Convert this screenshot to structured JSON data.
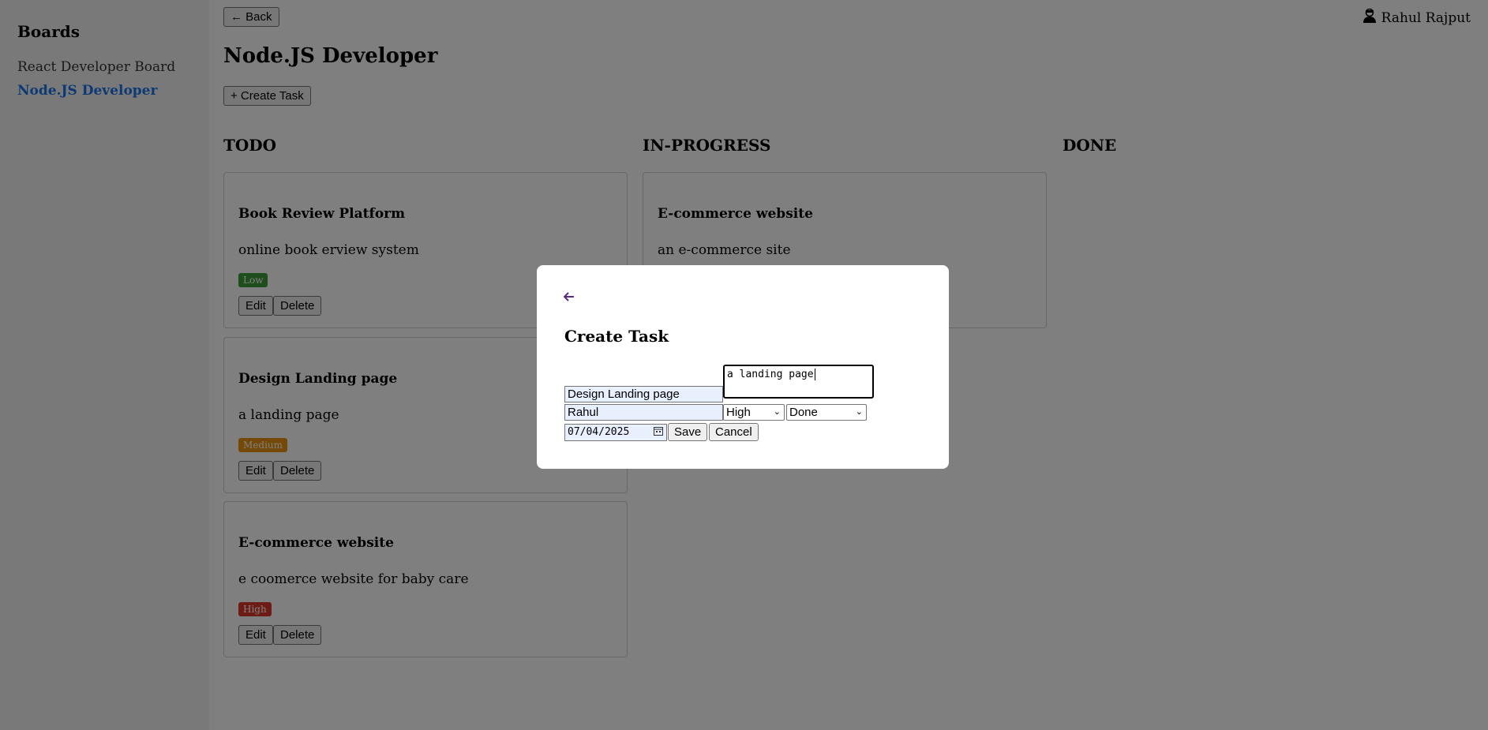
{
  "sidebar": {
    "heading": "Boards",
    "items": [
      {
        "label": "React Developer Board"
      },
      {
        "label": "Node.JS Developer"
      }
    ]
  },
  "header": {
    "back_label": "← Back",
    "title": "Node.JS Developer",
    "create_task_label": "+ Create Task",
    "user_name": "Rahul Rajput"
  },
  "columns": [
    {
      "title": "TODO"
    },
    {
      "title": "IN-PROGRESS"
    },
    {
      "title": "DONE"
    }
  ],
  "cards": {
    "todo": [
      {
        "title": "Book Review Platform",
        "description": "online book erview system",
        "priority": "Low",
        "priority_color": "#3c9a3c"
      },
      {
        "title": "Design Landing page",
        "description": "a landing page",
        "priority": "Medium",
        "priority_color": "#e8920c"
      },
      {
        "title": "E-commerce website",
        "description": "e coomerce website for baby care",
        "priority": "High",
        "priority_color": "#d9372b"
      }
    ],
    "in_progress": [
      {
        "title": "E-commerce website",
        "description": "an e-commerce site"
      }
    ]
  },
  "card_actions": {
    "edit_label": "Edit",
    "delete_label": "Delete"
  },
  "modal": {
    "title": "Create Task",
    "title_value": "Design Landing page",
    "description_value": "a landing page",
    "assignee_value": "Rahul",
    "priority_value": "High",
    "status_value": "Done",
    "date_value": "07/04/2025",
    "save_label": "Save",
    "cancel_label": "Cancel"
  },
  "colors": {
    "accent": "#1a73e8",
    "modal_back_arrow": "#5a2a82",
    "autofill_bg": "#e8f0fe"
  }
}
